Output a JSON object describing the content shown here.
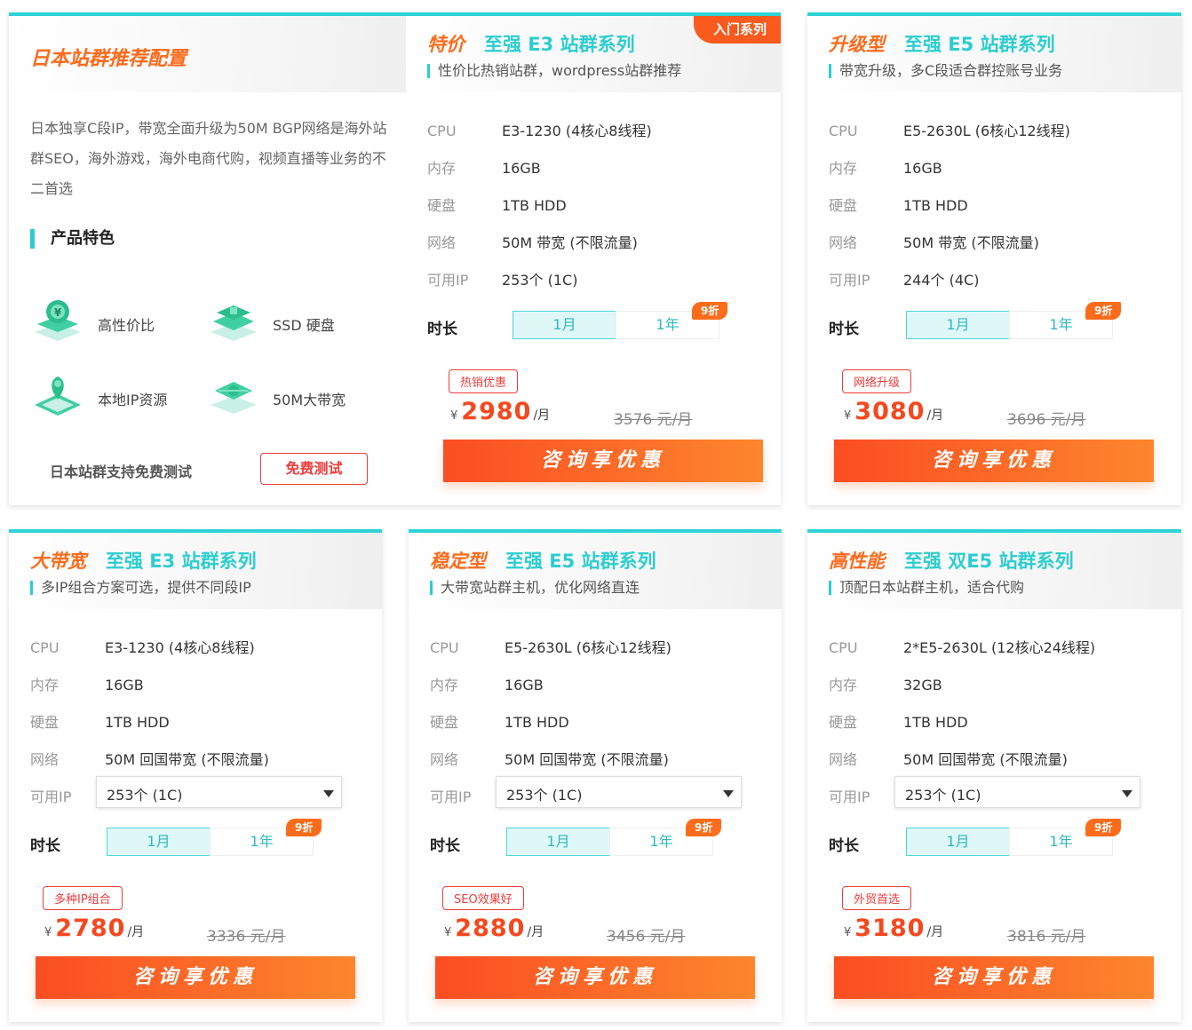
{
  "intro": {
    "title": "日本站群推荐配置",
    "description": "日本独享C段IP，带宽全面升级为50M BGP网络是海外站群SEO，海外游戏，海外电商代购，视频直播等业务的不二首选",
    "features_heading": "产品特色",
    "features": [
      {
        "label": "高性价比",
        "icon": "money-icon"
      },
      {
        "label": "SSD 硬盘",
        "icon": "ssd-icon"
      },
      {
        "label": "本地IP资源",
        "icon": "location-icon"
      },
      {
        "label": "50M大带宽",
        "icon": "network-icon"
      }
    ],
    "free_test_label": "日本站群支持免费测试",
    "free_test_button": "免费测试"
  },
  "spec_labels": {
    "cpu": "CPU",
    "mem": "内存",
    "disk": "硬盘",
    "net": "网络",
    "ip": "可用IP",
    "duration": "时长"
  },
  "duration_options": {
    "month": "1月",
    "year": "1年",
    "discount": "9折"
  },
  "cta_label": "咨询享优惠",
  "currency": "¥",
  "per_month": "/月",
  "plans": [
    {
      "tag": "特价",
      "series": "至强 E3 站群系列",
      "corner": "入门系列",
      "subtitle": "性价比热销站群，wordpress站群推荐",
      "cpu": "E3-1230 (4核心8线程)",
      "mem": "16GB",
      "disk": "1TB HDD",
      "net": "50M 带宽 (不限流量)",
      "ip": "253个 (1C)",
      "badge": "热销优惠",
      "price": "2980",
      "orig": "3576 元/月"
    },
    {
      "tag": "升级型",
      "series": "至强 E5 站群系列",
      "subtitle": "带宽升级，多C段适合群控账号业务",
      "cpu": "E5-2630L (6核心12线程)",
      "mem": "16GB",
      "disk": "1TB HDD",
      "net": "50M 带宽 (不限流量)",
      "ip": "244个 (4C)",
      "badge": "网络升级",
      "price": "3080",
      "orig": "3696 元/月"
    },
    {
      "tag": "大带宽",
      "series": "至强 E3 站群系列",
      "subtitle": "多IP组合方案可选，提供不同段IP",
      "cpu": "E3-1230 (4核心8线程)",
      "mem": "16GB",
      "disk": "1TB HDD",
      "net": "50M 回国带宽 (不限流量)",
      "ip": "253个 (1C)",
      "badge": "多种IP组合",
      "price": "2780",
      "orig": "3336 元/月"
    },
    {
      "tag": "稳定型",
      "series": "至强 E5 站群系列",
      "subtitle": "大带宽站群主机，优化网络直连",
      "cpu": "E5-2630L (6核心12线程)",
      "mem": "16GB",
      "disk": "1TB HDD",
      "net": "50M 回国带宽 (不限流量)",
      "ip": "253个 (1C)",
      "badge": "SEO效果好",
      "price": "2880",
      "orig": "3456 元/月"
    },
    {
      "tag": "高性能",
      "series": "至强 双E5 站群系列",
      "subtitle": "顶配日本站群主机，适合代购",
      "cpu": "2*E5-2630L (12核心24线程)",
      "mem": "32GB",
      "disk": "1TB HDD",
      "net": "50M 回国带宽 (不限流量)",
      "ip": "253个 (1C)",
      "badge": "外贸首选",
      "price": "3180",
      "orig": "3816 元/月"
    }
  ]
}
